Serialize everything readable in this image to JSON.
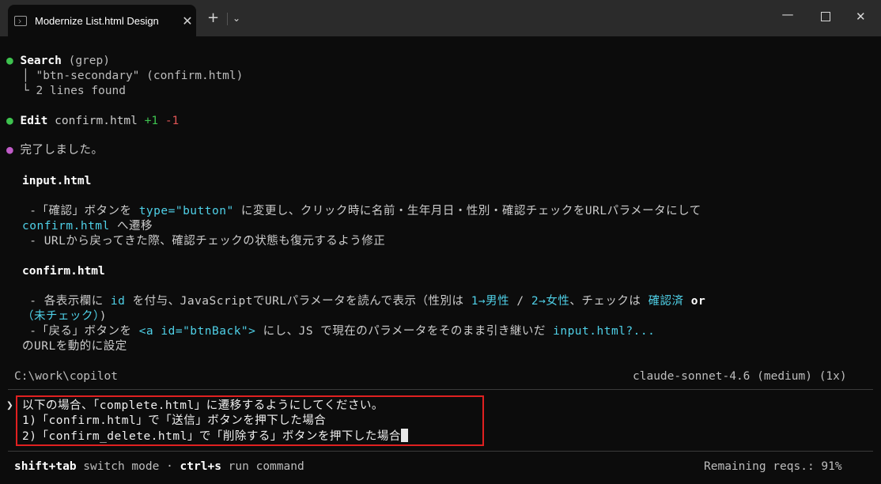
{
  "window": {
    "tab_title": "Modernize List.html Design",
    "tab_close": "✕",
    "new_tab": "+",
    "dropdown": "⌄",
    "minimize": "—",
    "close": "✕"
  },
  "search_block": {
    "dot": "●",
    "label": "Search",
    "tool": "(grep)",
    "query": "\"btn-secondary\" (confirm.html)",
    "result": "2 lines found",
    "pipe": "│",
    "corner": "└"
  },
  "edit_block": {
    "dot": "●",
    "label": "Edit",
    "file": "confirm.html",
    "added": "+1",
    "removed": "-1"
  },
  "response": {
    "dot": "●",
    "done": "完了しました。",
    "section1_title": "input.html",
    "s1_line1_a": " -「確認」ボタンを ",
    "s1_line1_code": "type=\"button\"",
    "s1_line1_b": " に変更し、クリック時に名前・生年月日・性別・確認チェックをURLパラメータにして",
    "s1_line2_code": "confirm.html",
    "s1_line2_b": " へ遷移",
    "s1_line3": " - URLから戻ってきた際、確認チェックの状態も復元するよう修正",
    "section2_title": "confirm.html",
    "s2_line1_a": " - 各表示欄に ",
    "s2_line1_code1": "id",
    "s2_line1_b": " を付与、JavaScriptでURLパラメータを読んで表示（性別は ",
    "s2_line1_code2": "1→男性",
    "s2_line1_c": " / ",
    "s2_line1_code3": "2→女性",
    "s2_line1_d": "、チェックは ",
    "s2_line1_code4": "確認済",
    "s2_line1_e": " or",
    "s2_line2_code": "（未チェック）",
    "s2_line2_b": ")",
    "s2_line3_a": " -「戻る」ボタンを ",
    "s2_line3_code1": "<a id=\"btnBack\">",
    "s2_line3_b": " にし、JS で現在のパラメータをそのまま引き継いだ ",
    "s2_line3_code2": "input.html?...",
    "s2_line4": "のURLを動的に設定"
  },
  "status": {
    "cwd": "C:\\work\\copilot",
    "model": "claude-sonnet-4.6 (medium) (1x)"
  },
  "prompt": {
    "marker": "❯",
    "line1": "以下の場合、「complete.html」に遷移するようにしてください。",
    "line2": "1)「confirm.html」で「送信」ボタンを押下した場合",
    "line3": "2)「confirm_delete.html」で「削除する」ボタンを押下した場合"
  },
  "footer": {
    "shortcut1_key": "shift+tab",
    "shortcut1_label": " switch mode",
    "dot_sep": " · ",
    "shortcut2_key": "ctrl+s",
    "shortcut2_label": " run command",
    "remaining": "Remaining reqs.: 91%"
  }
}
